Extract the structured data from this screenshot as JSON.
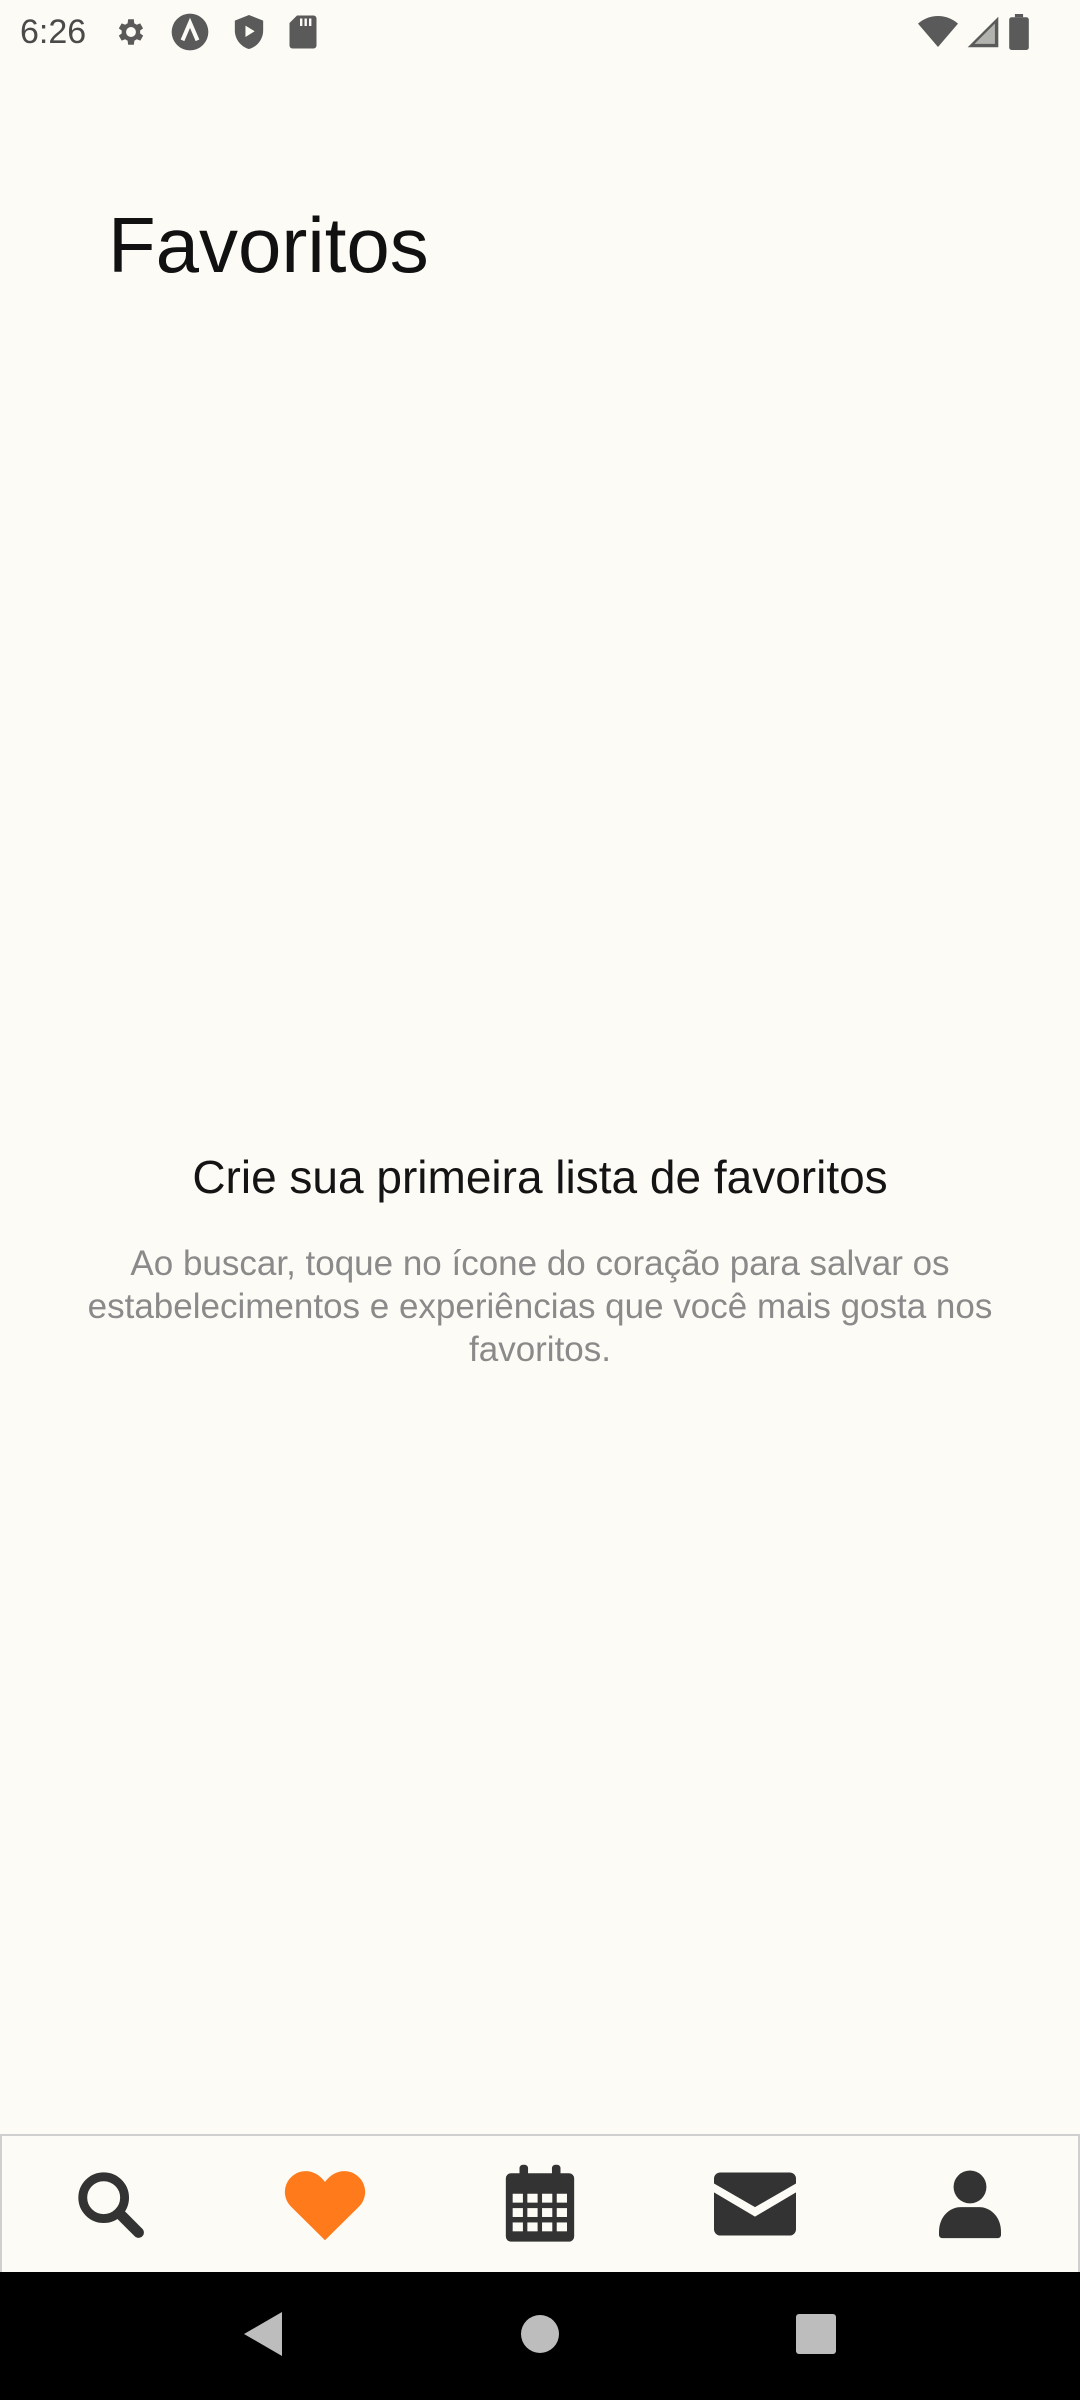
{
  "status_bar": {
    "time": "6:26",
    "left_icons": [
      "gear-icon",
      "a-icon",
      "shield-play-icon",
      "sd-card-icon"
    ],
    "right_icons": [
      "wifi-icon",
      "signal-icon",
      "battery-icon"
    ]
  },
  "header": {
    "title": "Favoritos"
  },
  "empty_state": {
    "heading": "Crie sua primeira lista de favoritos",
    "description": "Ao buscar, toque no ícone do coração para salvar os estabelecimentos e experiências que você mais gosta nos favoritos."
  },
  "tab_bar": {
    "items": [
      {
        "icon": "search-icon",
        "active": false
      },
      {
        "icon": "heart-icon",
        "active": true
      },
      {
        "icon": "calendar-icon",
        "active": false
      },
      {
        "icon": "envelope-icon",
        "active": false
      },
      {
        "icon": "user-icon",
        "active": false
      }
    ],
    "active_color": "#ff7a1a",
    "inactive_color": "#333333"
  },
  "nav_bar": {
    "buttons": [
      "back-icon",
      "home-icon",
      "recents-icon"
    ]
  }
}
